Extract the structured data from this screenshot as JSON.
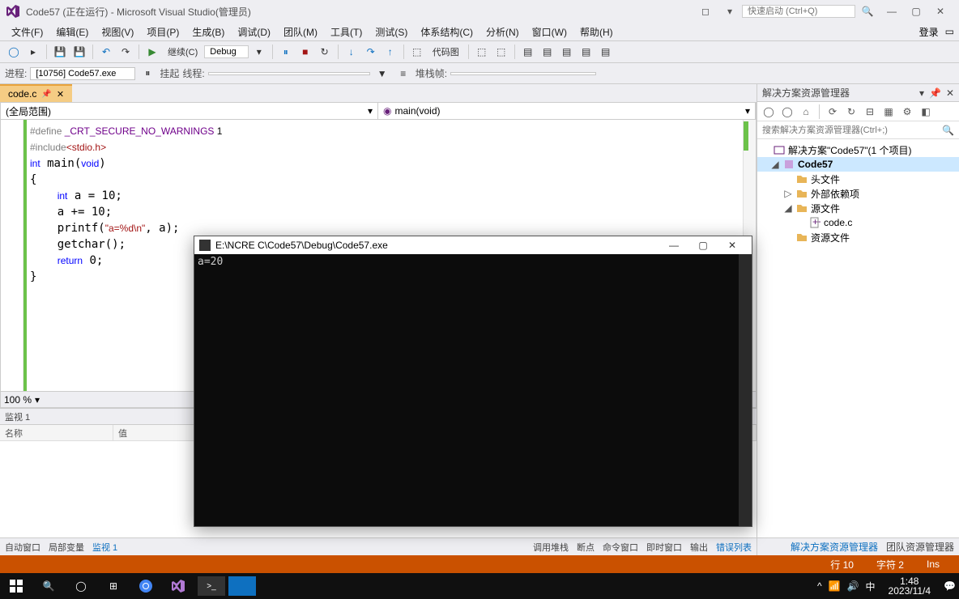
{
  "title": "Code57 (正在运行) - Microsoft Visual Studio(管理员)",
  "login": "登录",
  "quick_launch_placeholder": "快速启动 (Ctrl+Q)",
  "menu": {
    "file": "文件(F)",
    "edit": "编辑(E)",
    "view": "视图(V)",
    "project": "项目(P)",
    "build": "生成(B)",
    "debug": "调试(D)",
    "team": "团队(M)",
    "tools": "工具(T)",
    "test": "测试(S)",
    "arch": "体系结构(C)",
    "analyze": "分析(N)",
    "window": "窗口(W)",
    "help": "帮助(H)"
  },
  "toolbar": {
    "continue": "继续(C)",
    "debug_mode": "Debug",
    "codemap": "代码图"
  },
  "debugbar": {
    "process_label": "进程:",
    "process": "[10756] Code57.exe",
    "suspend": "挂起",
    "thread_label": "线程:",
    "stackframe": "堆栈帧:"
  },
  "doc_tab": "code.c",
  "nav_left": "(全局范围)",
  "nav_right": "main(void)",
  "code": {
    "l1_pre": "#define ",
    "l1_mac": "_CRT_SECURE_NO_WARNINGS",
    "l1_val": " 1",
    "l2_pre": "#include",
    "l2_inc": "<stdio.h>",
    "l3": "int main(void)",
    "l4": "{",
    "l5": "    int a = 10;",
    "l6": "    a += 10;",
    "l7a": "    printf(",
    "l7s": "\"a=%d\\n\"",
    "l7b": ", a);",
    "l8": "    getchar();",
    "l9": "    return 0;",
    "l10": "}"
  },
  "zoom": "100 %",
  "watch": {
    "title": "监视 1",
    "col_name": "名称",
    "col_value": "值"
  },
  "bottom_tabs": {
    "auto": "自动窗口",
    "locals": "局部变量",
    "watch": "监视 1"
  },
  "right_bottom_tabs": {
    "callstack": "调用堆栈",
    "breakpoints": "断点",
    "command": "命令窗口",
    "immediate": "即时窗口",
    "output": "输出",
    "errors": "错误列表"
  },
  "sol": {
    "title": "解决方案资源管理器",
    "search_placeholder": "搜索解决方案资源管理器(Ctrl+;)",
    "root": "解决方案\"Code57\"(1 个项目)",
    "project": "Code57",
    "headers": "头文件",
    "external": "外部依赖项",
    "source": "源文件",
    "codec": "code.c",
    "resource": "资源文件",
    "bot_active": "解决方案资源管理器",
    "bot_other": "团队资源管理器"
  },
  "status": {
    "line": "行 10",
    "char": "字符 2",
    "ins": "Ins"
  },
  "console": {
    "title": "E:\\NCRE C\\Code57\\Debug\\Code57.exe",
    "output": "a=20"
  },
  "taskbar": {
    "time": "1:48",
    "date": "2023/11/4",
    "lang": "中"
  }
}
